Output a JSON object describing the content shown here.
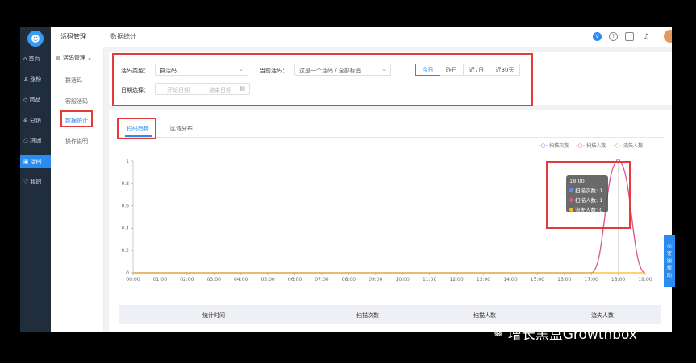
{
  "nav": {
    "items": [
      {
        "icon": "home-icon",
        "glyph": "⌂",
        "label": "首页"
      },
      {
        "icon": "user-icon",
        "glyph": "♙",
        "label": "涨粉"
      },
      {
        "icon": "tag-icon",
        "glyph": "◇",
        "label": "商品"
      },
      {
        "icon": "share-icon",
        "glyph": "⊛",
        "label": "分销"
      },
      {
        "icon": "group-icon",
        "glyph": "◌",
        "label": "拼团"
      },
      {
        "icon": "qrcode-icon",
        "glyph": "▣",
        "label": "活码"
      },
      {
        "icon": "heart-icon",
        "glyph": "♡",
        "label": "我的"
      }
    ]
  },
  "topbar": {
    "module": "活码管理",
    "page": "数据统计",
    "help": "?",
    "message": "▢",
    "bell": "♫"
  },
  "submenu": {
    "header": "活码管理",
    "items": [
      "群活码",
      "客服活码",
      "数据统计",
      "操作说明"
    ]
  },
  "filters": {
    "type_label": "活码类型：",
    "type_value": "群活码",
    "current_label": "当前活码：",
    "current_value": "这是一个活码 / 全部标签",
    "date_label": "日期选择：",
    "date_start": "开始日期",
    "date_sep": "~",
    "date_end": "结束日期",
    "quick": [
      "今日",
      "昨日",
      "近7日",
      "近30天"
    ]
  },
  "tabs": [
    "扫码趋势",
    "区域分布"
  ],
  "chart_data": {
    "type": "line",
    "x": [
      "00:00",
      "01:00",
      "02:00",
      "03:00",
      "04:00",
      "05:00",
      "06:00",
      "07:00",
      "08:00",
      "09:00",
      "10:00",
      "11:00",
      "12:00",
      "13:00",
      "14:00",
      "15:00",
      "16:00",
      "17:00",
      "18:00",
      "19:00"
    ],
    "series": [
      {
        "name": "扫描次数",
        "color": "#5b8ff9",
        "values": [
          0,
          0,
          0,
          0,
          0,
          0,
          0,
          0,
          0,
          0,
          0,
          0,
          0,
          0,
          0,
          0,
          0,
          0,
          1,
          0
        ]
      },
      {
        "name": "扫描人数",
        "color": "#e8558a",
        "values": [
          0,
          0,
          0,
          0,
          0,
          0,
          0,
          0,
          0,
          0,
          0,
          0,
          0,
          0,
          0,
          0,
          0,
          0,
          1,
          0
        ]
      },
      {
        "name": "流失人数",
        "color": "#f5b925",
        "values": [
          0,
          0,
          0,
          0,
          0,
          0,
          0,
          0,
          0,
          0,
          0,
          0,
          0,
          0,
          0,
          0,
          0,
          0,
          0,
          0
        ]
      }
    ],
    "yticks": [
      "0",
      "0.2",
      "0.4",
      "0.6",
      "0.8",
      "1"
    ],
    "ylim": [
      0,
      1
    ],
    "legend": "top-right"
  },
  "tooltip": {
    "time": "18:00",
    "rows": [
      "扫描次数: 1",
      "扫描人数: 1",
      "流失人数: 0"
    ]
  },
  "table": {
    "headers": [
      "统计时间",
      "扫描次数",
      "扫描人数",
      "流失人数"
    ]
  },
  "sidebtn": [
    "客",
    "服",
    "帮",
    "助"
  ],
  "watermark": "增长黑盒Growthbox"
}
